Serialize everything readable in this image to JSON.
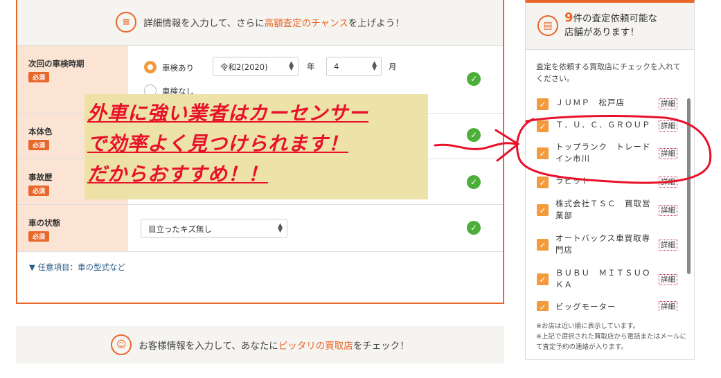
{
  "form": {
    "header_pre": "詳細情報を入力して、さらに",
    "header_hl": "高額査定のチャンス",
    "header_post": "を上げよう！",
    "rows": [
      {
        "label": "次回の車検時期",
        "required": "必須"
      },
      {
        "label": "本体色",
        "required": "必須"
      },
      {
        "label": "事故歴",
        "required": "必須"
      },
      {
        "label": "車の状態",
        "required": "必須"
      }
    ],
    "inspection": {
      "radio_yes": "車検あり",
      "radio_no": "車検なし",
      "year_value": "令和2(2020)",
      "year_unit": "年",
      "month_value": "4",
      "month_unit": "月"
    },
    "condition_value": "目立ったキズ無し",
    "optional_link": "▼ 任意項目：車の型式など"
  },
  "banner": {
    "line1": "外車に強い業者はカーセンサー",
    "line2": "で効率よく見つけられます！",
    "line3": "だからおすすめ！！"
  },
  "customer": {
    "pre": "お客様情報を入力して、あなたに",
    "hl": "ピッタリの買取店",
    "post": "をチェック！"
  },
  "sidebar": {
    "count": "9",
    "title_rest": "件の査定依頼可能な",
    "title_line2": "店舗があります！",
    "intro": "査定を依頼する買取店にチェックを入れてください。",
    "detail_label": "詳細",
    "shops": [
      "ＪＵＭＰ　松戸店",
      "Ｔ．Ｕ．Ｃ．ＧＲＯＵＰ",
      "トップランク　トレードイン市川",
      "ラビット",
      "株式会社ＴＳＣ　買取営業部",
      "オートバックス車買取専門店",
      "ＢＵＢＵ　ＭＩＴＳＵＯＫＡ",
      "ビッグモーター"
    ],
    "note1": "※お店は近い順に表示しています。",
    "note2": "※上記で選択された買取店から電話またはメールにて査定予約の連絡が入ります。"
  },
  "colors": {
    "accent": "#e8672a",
    "check_green": "#4caf3a",
    "annotation_red": "#e8112a"
  }
}
